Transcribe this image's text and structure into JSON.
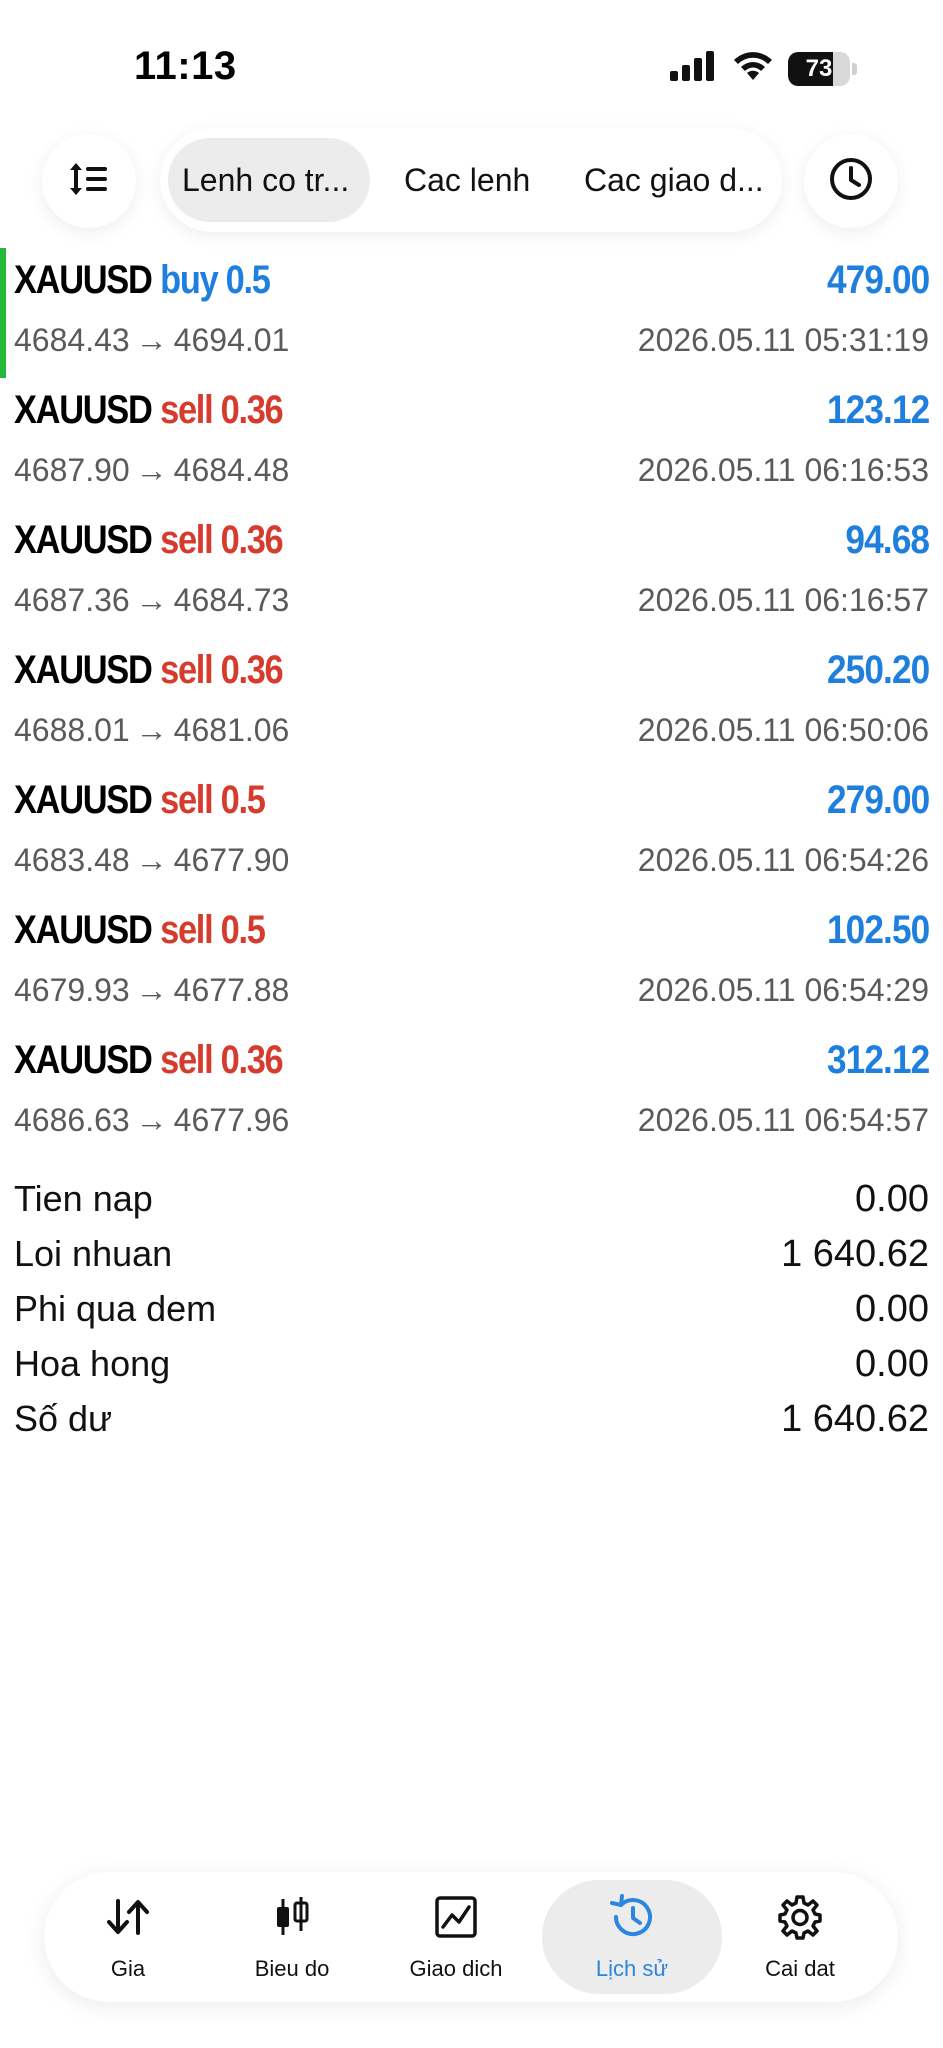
{
  "status_bar": {
    "time": "11:13",
    "battery": "73",
    "battery_level_percent": 73,
    "icons": [
      "signal-icon",
      "wifi-icon",
      "battery-icon"
    ]
  },
  "toolbar": {
    "sort_icon": "sort-icon",
    "clock_icon": "clock-icon",
    "tabs": [
      {
        "label": "Lenh co tr...",
        "active": true
      },
      {
        "label": "Cac lenh",
        "active": false
      },
      {
        "label": "Cac giao d...",
        "active": false
      }
    ]
  },
  "colors": {
    "buy": "#1f7fde",
    "sell": "#d63c2e",
    "profit": "#1f7fde",
    "highlight_bar": "#25b93b",
    "nav_active": "#2d86de"
  },
  "trades": [
    {
      "symbol": "XAUUSD",
      "side": "buy 0.5",
      "type": "buy",
      "profit": "479.00",
      "open_price": "4684.43",
      "close_price": "4694.01",
      "arrow": "→",
      "time": "2026.05.11 05:31:19"
    },
    {
      "symbol": "XAUUSD",
      "side": "sell 0.36",
      "type": "sell",
      "profit": "123.12",
      "open_price": "4687.90",
      "close_price": "4684.48",
      "arrow": "→",
      "time": "2026.05.11 06:16:53"
    },
    {
      "symbol": "XAUUSD",
      "side": "sell 0.36",
      "type": "sell",
      "profit": "94.68",
      "open_price": "4687.36",
      "close_price": "4684.73",
      "arrow": "→",
      "time": "2026.05.11 06:16:57"
    },
    {
      "symbol": "XAUUSD",
      "side": "sell 0.36",
      "type": "sell",
      "profit": "250.20",
      "open_price": "4688.01",
      "close_price": "4681.06",
      "arrow": "→",
      "time": "2026.05.11 06:50:06"
    },
    {
      "symbol": "XAUUSD",
      "side": "sell 0.5",
      "type": "sell",
      "profit": "279.00",
      "open_price": "4683.48",
      "close_price": "4677.90",
      "arrow": "→",
      "time": "2026.05.11 06:54:26"
    },
    {
      "symbol": "XAUUSD",
      "side": "sell 0.5",
      "type": "sell",
      "profit": "102.50",
      "open_price": "4679.93",
      "close_price": "4677.88",
      "arrow": "→",
      "time": "2026.05.11 06:54:29"
    },
    {
      "symbol": "XAUUSD",
      "side": "sell 0.36",
      "type": "sell",
      "profit": "312.12",
      "open_price": "4686.63",
      "close_price": "4677.96",
      "arrow": "→",
      "time": "2026.05.11 06:54:57"
    }
  ],
  "summary": [
    {
      "label": "Tien nap",
      "value": "0.00"
    },
    {
      "label": "Loi nhuan",
      "value": "1 640.62"
    },
    {
      "label": "Phi qua dem",
      "value": "0.00"
    },
    {
      "label": "Hoa hong",
      "value": "0.00"
    },
    {
      "label": "Số dư",
      "value": "1 640.62"
    }
  ],
  "bottom_nav": [
    {
      "label": "Gia",
      "icon": "price-arrows-icon",
      "active": false
    },
    {
      "label": "Bieu do",
      "icon": "candlestick-icon",
      "active": false
    },
    {
      "label": "Giao dich",
      "icon": "trade-chart-icon",
      "active": false
    },
    {
      "label": "Lịch sử",
      "icon": "history-icon",
      "active": true
    },
    {
      "label": "Cai dat",
      "icon": "gear-icon",
      "active": false
    }
  ]
}
